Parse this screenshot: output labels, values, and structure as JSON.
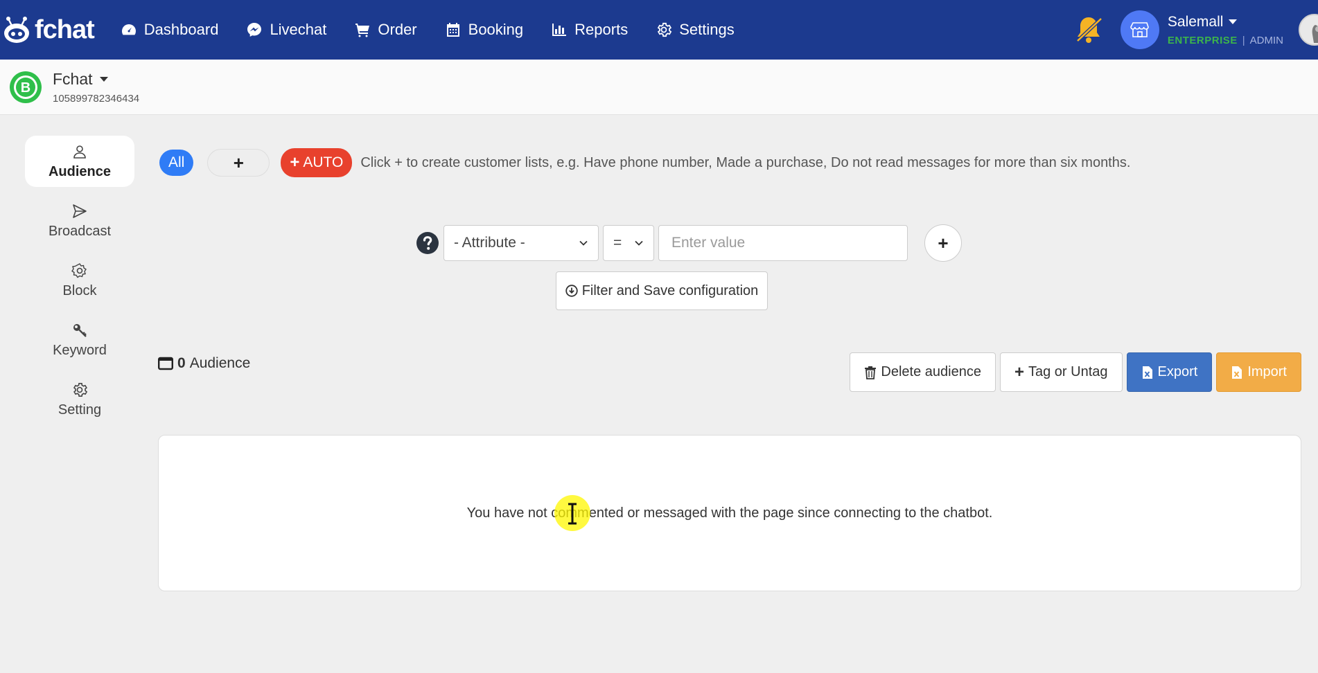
{
  "app": {
    "logo_text": "fchat"
  },
  "nav": {
    "items": [
      {
        "label": "Dashboard",
        "icon": "dashboard-icon"
      },
      {
        "label": "Livechat",
        "icon": "messenger-icon"
      },
      {
        "label": "Order",
        "icon": "cart-icon"
      },
      {
        "label": "Booking",
        "icon": "calendar-icon"
      },
      {
        "label": "Reports",
        "icon": "bar-chart-icon"
      },
      {
        "label": "Settings",
        "icon": "gear-icon"
      }
    ]
  },
  "account": {
    "name": "Salemall",
    "plan": "ENTERPRISE",
    "separator": "|",
    "role": "ADMIN"
  },
  "page": {
    "name": "Fchat",
    "id": "105899782346434"
  },
  "sidebar": {
    "items": [
      {
        "label": "Audience",
        "icon": "user-icon",
        "active": true
      },
      {
        "label": "Broadcast",
        "icon": "send-icon",
        "active": false
      },
      {
        "label": "Block",
        "icon": "block-icon",
        "active": false
      },
      {
        "label": "Keyword",
        "icon": "key-icon",
        "active": false
      },
      {
        "label": "Setting",
        "icon": "gear-icon",
        "active": false
      }
    ]
  },
  "tags": {
    "all_label": "All",
    "add_label": "+",
    "auto_plus": "+",
    "auto_label": "AUTO",
    "hint": "Click + to create customer lists, e.g. Have phone number, Made a purchase, Do not read messages for more than six months."
  },
  "filter": {
    "attribute_selected": "- Attribute -",
    "operator_selected": "=",
    "value_placeholder": "Enter value",
    "add_label": "+",
    "save_label": "Filter and Save configuration"
  },
  "audience": {
    "count": "0",
    "label": "Audience"
  },
  "actions": {
    "delete_label": "Delete audience",
    "tag_plus": "+",
    "tag_label": "Tag or Untag",
    "export_label": "Export",
    "import_label": "Import"
  },
  "empty_state": {
    "message": "You have not commented or messaged with the page since connecting to the chatbot."
  },
  "colors": {
    "navbar": "#1c3a8f",
    "all_pill": "#2f7cf6",
    "auto_pill": "#e8412d",
    "export": "#3f73c4",
    "import": "#f2ac47",
    "plan": "#3cb44b",
    "bell": "#f5b325"
  }
}
